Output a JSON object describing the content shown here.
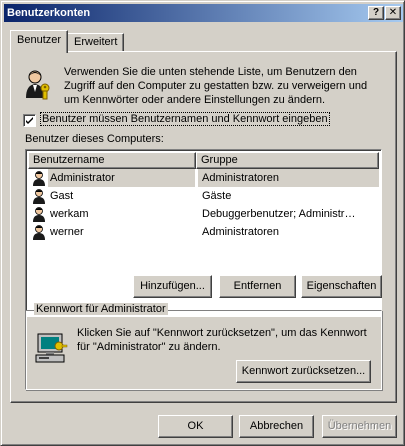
{
  "window": {
    "title": "Benutzerkonten",
    "help_button": "?",
    "close_button": "✕"
  },
  "tabs": [
    {
      "label": "Benutzer",
      "active": true
    },
    {
      "label": "Erweitert",
      "active": false
    }
  ],
  "users_tab": {
    "intro_text": "Verwenden Sie die unten stehende Liste, um Benutzern den Zugriff auf den Computer zu gestatten bzw. zu verweigern und um Kennwörter oder andere Einstellungen zu ändern.",
    "require_login_checkbox": {
      "label": "Benutzer müssen Benutzernamen und Kennwort eingeben",
      "checked": true
    },
    "list_label": "Benutzer dieses Computers:",
    "columns": [
      "Benutzername",
      "Gruppe"
    ],
    "users": [
      {
        "name": "Administrator",
        "group": "Administratoren",
        "selected": true
      },
      {
        "name": "Gast",
        "group": "Gäste",
        "selected": false
      },
      {
        "name": "werkam",
        "group": "Debuggerbenutzer; Administr…",
        "selected": false
      },
      {
        "name": "werner",
        "group": "Administratoren",
        "selected": false
      }
    ],
    "buttons": {
      "add": "Hinzufügen...",
      "remove": "Entfernen",
      "properties": "Eigenschaften"
    },
    "password_group": {
      "title": "Kennwort für Administrator",
      "text": "Klicken Sie auf \"Kennwort zurücksetzen\", um das Kennwort für \"Administrator\" zu ändern.",
      "reset_button": "Kennwort zurücksetzen..."
    }
  },
  "dialog_buttons": {
    "ok": "OK",
    "cancel": "Abbrechen",
    "apply": "Übernehmen"
  },
  "colors": {
    "titlebar_start": "#0a246a",
    "titlebar_end": "#a6caf0",
    "face": "#d4d0c8"
  }
}
